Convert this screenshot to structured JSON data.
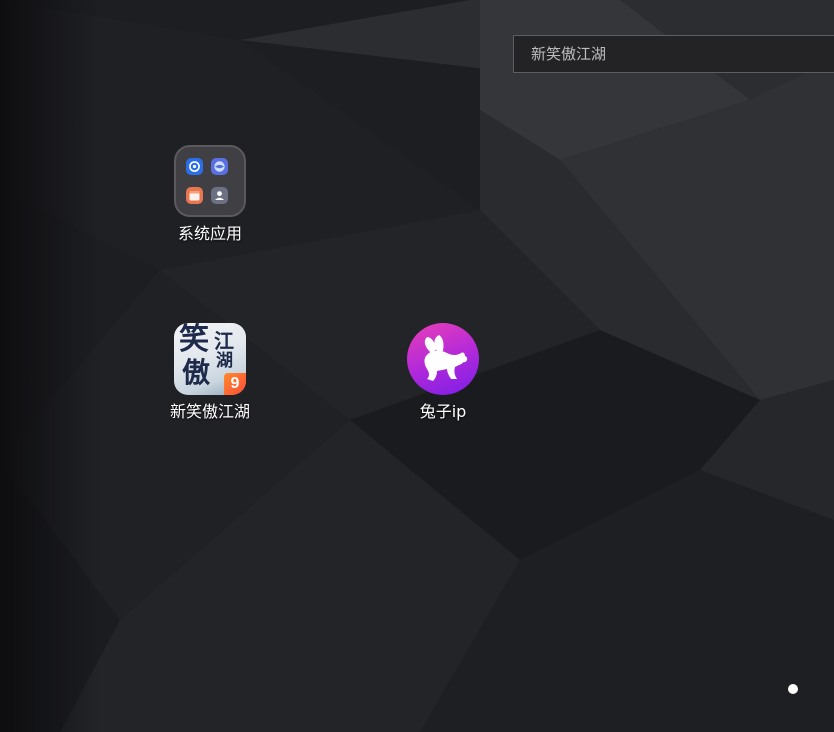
{
  "search": {
    "placeholder": "新笑傲江湖"
  },
  "apps": {
    "folder": {
      "label": "系统应用",
      "mini_icons": [
        "settings-icon",
        "browser-icon",
        "notes-icon",
        "contacts-icon"
      ]
    },
    "game": {
      "label": "新笑傲江湖",
      "glyphs": [
        "笑",
        "傲",
        "江",
        "湖"
      ],
      "badge": "9"
    },
    "rabbit": {
      "label": "兔子ip",
      "icon": "rabbit-icon"
    }
  },
  "pager": {
    "current_page": 1,
    "total_pages": 1
  },
  "colors": {
    "wallpaper": "#1b1c20",
    "rabbit_gradient_start": "#e93fb7",
    "rabbit_gradient_end": "#7a1ee8",
    "settings_blue": "#2a6ee8",
    "notes_orange": "#e8764f"
  }
}
